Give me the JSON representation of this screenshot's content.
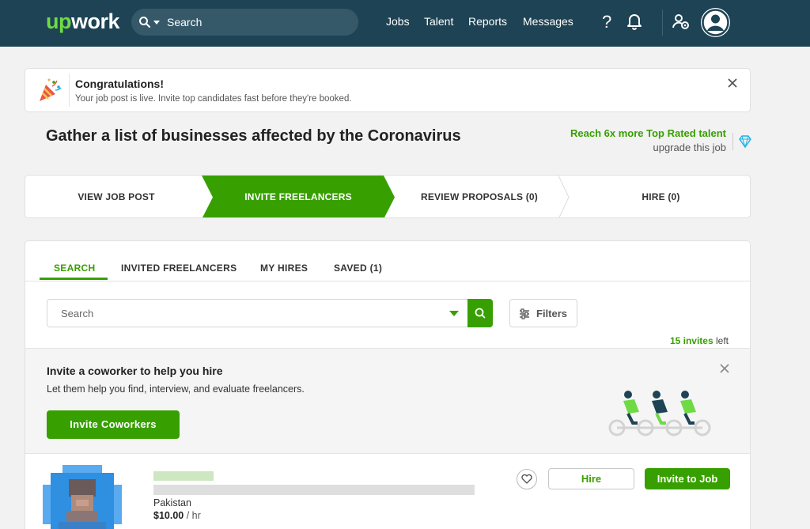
{
  "nav": {
    "logo_up": "up",
    "logo_work": "work",
    "search_placeholder": "Search",
    "links": [
      "Jobs",
      "Talent",
      "Reports",
      "Messages"
    ],
    "icons": [
      "help-icon",
      "bell-icon",
      "team-settings-icon",
      "user-avatar"
    ]
  },
  "banner": {
    "title": "Congratulations!",
    "message": "Your job post is live. Invite top candidates fast before they're booked.",
    "icon": "party-popper-icon"
  },
  "job": {
    "title": "Gather a list of businesses affected by the Coronavirus",
    "reach_text": "Reach 6x more Top Rated talent",
    "upgrade_text": "upgrade this job",
    "upgrade_icon": "diamond-icon"
  },
  "steps": [
    {
      "label": "VIEW JOB POST"
    },
    {
      "label": "INVITE FREELANCERS",
      "active": true
    },
    {
      "label": "REVIEW PROPOSALS (0)"
    },
    {
      "label": "HIRE (0)"
    }
  ],
  "tabs": [
    "SEARCH",
    "INVITED FREELANCERS",
    "MY HIRES",
    "SAVED (1)"
  ],
  "search": {
    "placeholder": "Search",
    "filters_label": "Filters",
    "invites_count": "15 invites",
    "invites_suffix": " left"
  },
  "coworker": {
    "heading": "Invite a coworker to help you hire",
    "text": "Let them help you find, interview, and evaluate freelancers.",
    "button": "Invite Coworkers"
  },
  "freelancer": {
    "country": "Pakistan",
    "rate": "$10.00",
    "rate_unit": " / hr",
    "hire_label": "Hire",
    "invite_label": "Invite to Job"
  },
  "colors": {
    "navbar": "#1d4354",
    "brand_green": "#37a000",
    "logo_green": "#6fda44",
    "diamond": "#1ab0e8"
  }
}
